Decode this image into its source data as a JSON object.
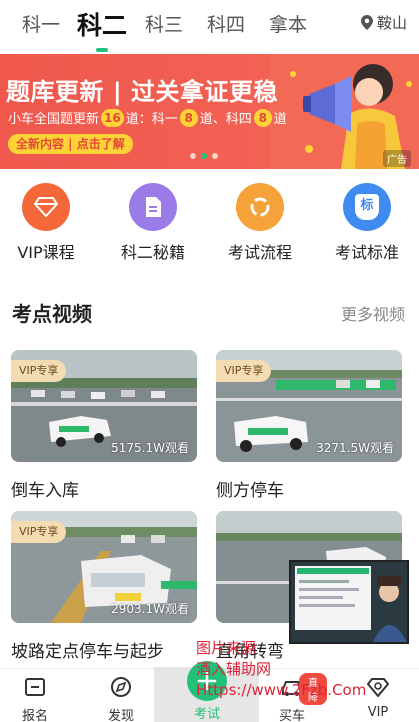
{
  "tabs": [
    {
      "label": "科一",
      "active": false
    },
    {
      "label": "科二",
      "active": true
    },
    {
      "label": "科三",
      "active": false
    },
    {
      "label": "科四",
      "active": false
    },
    {
      "label": "拿本",
      "active": false
    }
  ],
  "location": {
    "city": "鞍山",
    "icon": "location-pin-icon"
  },
  "banner": {
    "title": "题库更新 | 过关拿证更稳",
    "sub_prefix": "小车全国题更新",
    "sub_count_all": "16",
    "sub_mid1": "道：科一",
    "sub_count_k1": "8",
    "sub_mid2": "道、科四",
    "sub_count_k4": "8",
    "sub_suffix": "道",
    "button_label": "全新内容 | 点击了解",
    "ad_tag": "广告",
    "dots": 3,
    "active_dot": 2
  },
  "entries": [
    {
      "label": "VIP课程",
      "color": "#f4683a",
      "icon": "vip-diamond-icon"
    },
    {
      "label": "科二秘籍",
      "color": "#9a7be8",
      "icon": "document-icon"
    },
    {
      "label": "考试流程",
      "color": "#f6a23b",
      "icon": "flow-cycle-icon"
    },
    {
      "label": "考试标准",
      "color": "#3f8bf0",
      "icon": "standard-badge-icon",
      "badge_text": "标"
    }
  ],
  "section": {
    "title": "考点视频",
    "more": "更多视频"
  },
  "videos": [
    {
      "title": "倒车入库",
      "views": "5175.1W观看",
      "vip": "VIP专享"
    },
    {
      "title": "侧方停车",
      "views": "3271.5W观看",
      "vip": "VIP专享"
    },
    {
      "title": "坡路定点停车与起步",
      "views": "2903.1W观看",
      "vip": "VIP专享"
    },
    {
      "title": "直角转弯",
      "views": "",
      "vip": ""
    }
  ],
  "bottom_nav": [
    {
      "label": "报名",
      "icon": "signup-icon",
      "active": false
    },
    {
      "label": "发现",
      "icon": "discover-icon",
      "active": false
    },
    {
      "label": "考试",
      "icon": "exam-icon",
      "active": true
    },
    {
      "label": "买车",
      "icon": "car-icon",
      "active": false,
      "badge": "直降"
    },
    {
      "label": "VIP",
      "icon": "vip-diamond-icon",
      "active": false
    }
  ],
  "watermark": {
    "line1": "图片来源",
    "line2": "酒入辅助网",
    "line3": "Https://www.2Fzb.Com"
  },
  "colors": {
    "accent": "#21c17a",
    "banner": "#f0584c",
    "vip_badge": "#f4dcb2"
  }
}
